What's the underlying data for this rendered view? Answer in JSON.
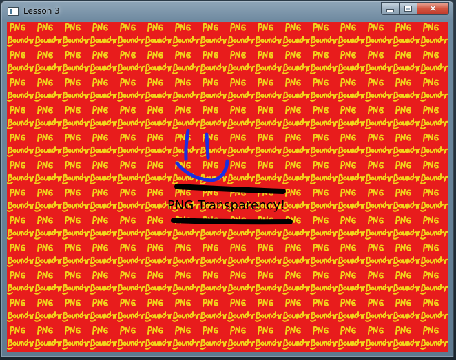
{
  "window": {
    "title": "Lesson 3",
    "icon": "app-window-icon",
    "controls": {
      "minimize_icon": "minimize-icon",
      "maximize_icon": "maximize-icon",
      "close_icon": "close-icon",
      "close_glyph": "✕"
    }
  },
  "canvas": {
    "background_color": "#e81c1c",
    "tile_text_color": "#f2d21b",
    "tile_top_text": "PNG",
    "tile_bottom_text": "Boundary"
  },
  "overlay": {
    "caption": "PNG Transparency!",
    "smiley_color": "#1b2ee0",
    "line_color": "#000000"
  }
}
